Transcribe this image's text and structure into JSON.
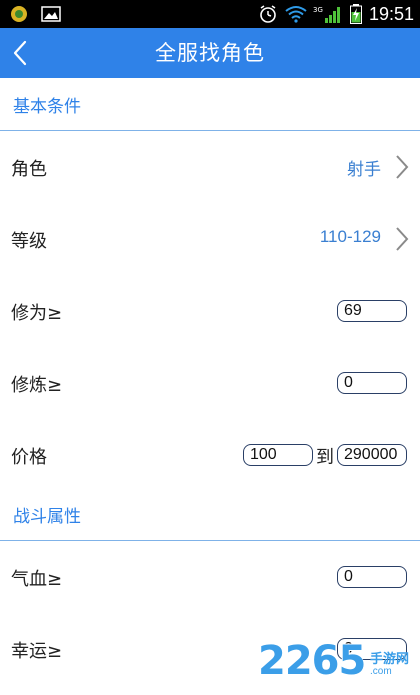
{
  "status_bar": {
    "time": "19:51",
    "network": "3G"
  },
  "header": {
    "title": "全服找角色"
  },
  "sections": {
    "basic": "基本条件",
    "combat": "战斗属性"
  },
  "rows": {
    "role": {
      "label": "角色",
      "value": "射手"
    },
    "level": {
      "label": "等级",
      "value": "110-129"
    },
    "cultivation": {
      "label": "修为≥",
      "value": "69"
    },
    "refining": {
      "label": "修炼≥",
      "value": "0"
    },
    "price": {
      "label": "价格",
      "min": "100",
      "separator": "到",
      "max": "290000"
    },
    "hp": {
      "label": "气血≥",
      "value": "0"
    },
    "luck": {
      "label": "幸运≥",
      "value": "0"
    }
  },
  "watermark": {
    "number": "2265",
    "suffix": ".com",
    "brand": "手游网"
  },
  "colors": {
    "accent": "#2f82e8",
    "value_text": "#3a7fd1"
  }
}
